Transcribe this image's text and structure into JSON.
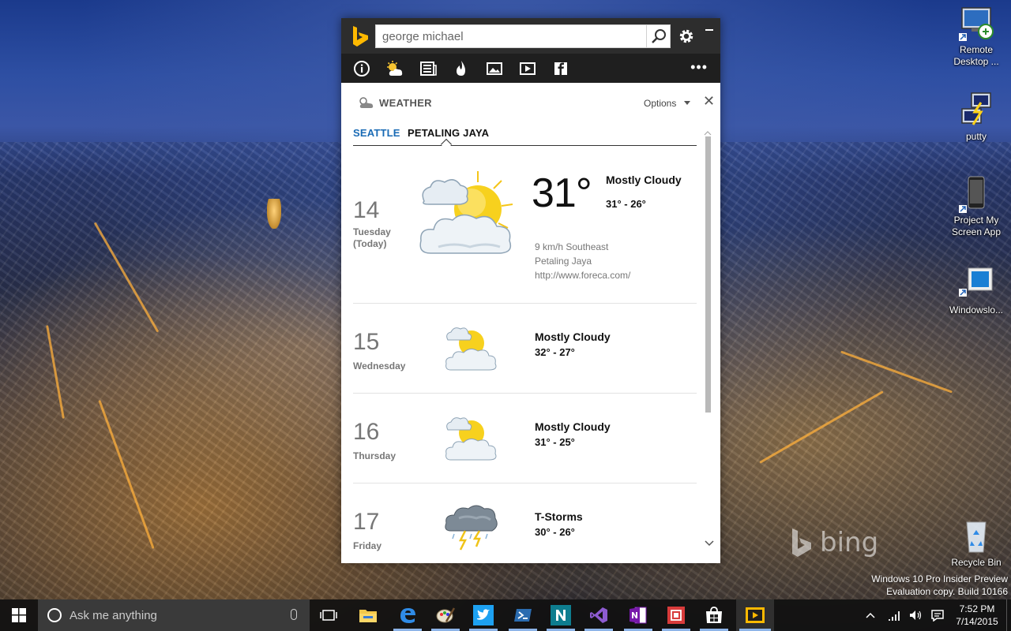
{
  "desktop": {
    "icons": [
      {
        "label": "Remote Desktop ...",
        "icon": "remote-desktop-icon"
      },
      {
        "label": "putty",
        "icon": "putty-icon"
      },
      {
        "label": "Project My Screen App",
        "icon": "project-screen-icon"
      },
      {
        "label": "Windowslo...",
        "icon": "windows-loader-icon"
      },
      {
        "label": "Recycle Bin",
        "icon": "recycle-bin-icon"
      }
    ],
    "watermark_brand": "bing",
    "watermark_line1": "Windows 10 Pro Insider Preview",
    "watermark_line2": "Evaluation copy. Build 10166"
  },
  "bing_app": {
    "search_value": "george michael",
    "nav_icons": [
      "info-icon",
      "weather-icon",
      "news-icon",
      "trending-icon",
      "images-icon",
      "video-icon",
      "facebook-icon"
    ],
    "more_label": "•••"
  },
  "weather": {
    "title": "WEATHER",
    "options_label": "Options",
    "close_label": "✕",
    "tabs": [
      {
        "label": "SEATTLE",
        "selected": false
      },
      {
        "label": "PETALING JAYA",
        "selected": true
      }
    ],
    "today": {
      "day_num": "14",
      "day_name": "Tuesday",
      "day_sub": "(Today)",
      "temp": "31°",
      "condition": "Mostly Cloudy",
      "range": "31° - 26°",
      "wind": "9 km/h Southeast",
      "location": "Petaling Jaya",
      "source": "http://www.foreca.com/",
      "icon": "sun-cloud-icon"
    },
    "forecast": [
      {
        "day_num": "15",
        "day_name": "Wednesday",
        "condition": "Mostly Cloudy",
        "range": "32° - 27°",
        "icon": "sun-cloud-icon"
      },
      {
        "day_num": "16",
        "day_name": "Thursday",
        "condition": "Mostly Cloudy",
        "range": "31° - 25°",
        "icon": "sun-cloud-icon"
      },
      {
        "day_num": "17",
        "day_name": "Friday",
        "condition": "T-Storms",
        "range": "30° - 26°",
        "icon": "thunderstorm-icon"
      }
    ]
  },
  "taskbar": {
    "search_placeholder": "Ask me anything",
    "apps": [
      "task-view-icon",
      "file-explorer-icon",
      "edge-icon",
      "paint-icon",
      "twitter-icon",
      "powershell-icon",
      "n-app-icon",
      "visual-studio-icon",
      "onenote-icon",
      "red-app-icon",
      "store-icon",
      "bing-app-icon"
    ],
    "time": "7:52 PM",
    "date": "7/14/2015",
    "colors": {
      "accent": "#8db4e8",
      "bing_gold": "#ffb900",
      "link_blue": "#1a6bb5"
    }
  }
}
